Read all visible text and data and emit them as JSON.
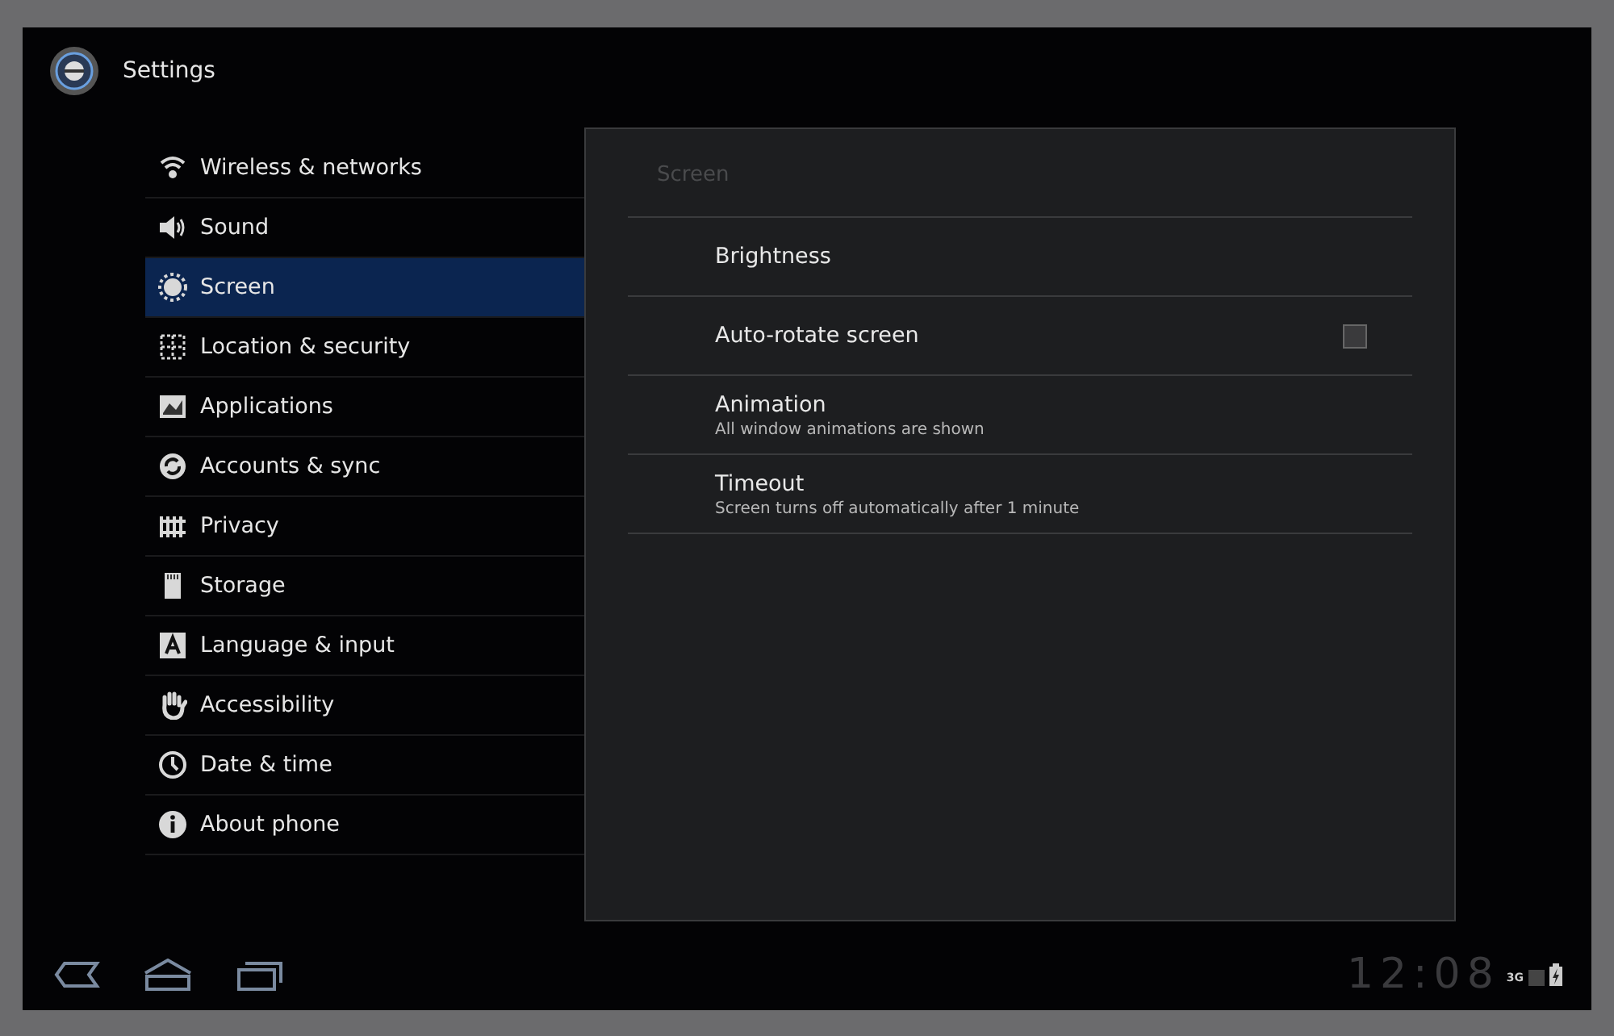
{
  "title_bar": {
    "title": "Settings"
  },
  "sidebar": {
    "items": [
      {
        "label": "Wireless & networks",
        "selected": false
      },
      {
        "label": "Sound",
        "selected": false
      },
      {
        "label": "Screen",
        "selected": true
      },
      {
        "label": "Location & security",
        "selected": false
      },
      {
        "label": "Applications",
        "selected": false
      },
      {
        "label": "Accounts & sync",
        "selected": false
      },
      {
        "label": "Privacy",
        "selected": false
      },
      {
        "label": "Storage",
        "selected": false
      },
      {
        "label": "Language & input",
        "selected": false
      },
      {
        "label": "Accessibility",
        "selected": false
      },
      {
        "label": "Date & time",
        "selected": false
      },
      {
        "label": "About phone",
        "selected": false
      }
    ]
  },
  "detail": {
    "header": "Screen",
    "rows": [
      {
        "kind": "plain",
        "title": "Brightness"
      },
      {
        "kind": "checkbox",
        "title": "Auto-rotate screen",
        "checked": false
      },
      {
        "kind": "summary",
        "title": "Animation",
        "summary": "All window animations are shown"
      },
      {
        "kind": "summary",
        "title": "Timeout",
        "summary": "Screen turns off automatically after 1 minute"
      }
    ]
  },
  "status_bar": {
    "clock": "12:08",
    "network": "3G"
  }
}
